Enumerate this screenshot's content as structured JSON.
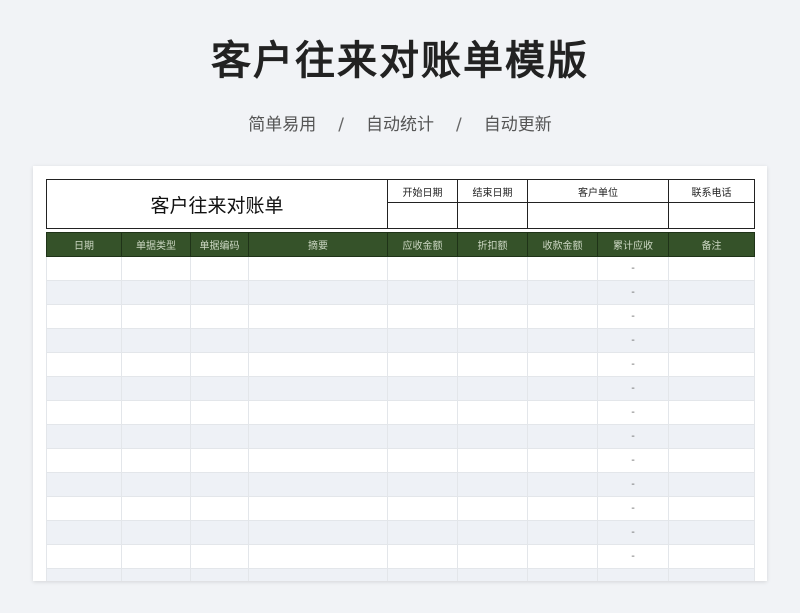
{
  "title": "客户往来对账单模版",
  "subtitle": {
    "items": [
      "简单易用",
      "自动统计",
      "自动更新"
    ],
    "separator": "/"
  },
  "sheet": {
    "header": {
      "doc_title": "客户往来对账单",
      "fields": [
        "开始日期",
        "结束日期",
        "客户单位",
        "联系电话"
      ]
    },
    "columns": [
      "日期",
      "单据类型",
      "单据编码",
      "摘要",
      "应收金额",
      "折扣额",
      "收款金额",
      "累计应收",
      "备注"
    ],
    "rows": [
      [
        "",
        "",
        "",
        "",
        "",
        "",
        "",
        "-",
        ""
      ],
      [
        "",
        "",
        "",
        "",
        "",
        "",
        "",
        "-",
        ""
      ],
      [
        "",
        "",
        "",
        "",
        "",
        "",
        "",
        "-",
        ""
      ],
      [
        "",
        "",
        "",
        "",
        "",
        "",
        "",
        "-",
        ""
      ],
      [
        "",
        "",
        "",
        "",
        "",
        "",
        "",
        "-",
        ""
      ],
      [
        "",
        "",
        "",
        "",
        "",
        "",
        "",
        "-",
        ""
      ],
      [
        "",
        "",
        "",
        "",
        "",
        "",
        "",
        "-",
        ""
      ],
      [
        "",
        "",
        "",
        "",
        "",
        "",
        "",
        "-",
        ""
      ],
      [
        "",
        "",
        "",
        "",
        "",
        "",
        "",
        "-",
        ""
      ],
      [
        "",
        "",
        "",
        "",
        "",
        "",
        "",
        "-",
        ""
      ],
      [
        "",
        "",
        "",
        "",
        "",
        "",
        "",
        "-",
        ""
      ],
      [
        "",
        "",
        "",
        "",
        "",
        "",
        "",
        "-",
        ""
      ],
      [
        "",
        "",
        "",
        "",
        "",
        "",
        "",
        "-",
        ""
      ],
      [
        "",
        "",
        "",
        "",
        "",
        "",
        "",
        "",
        ""
      ]
    ]
  }
}
